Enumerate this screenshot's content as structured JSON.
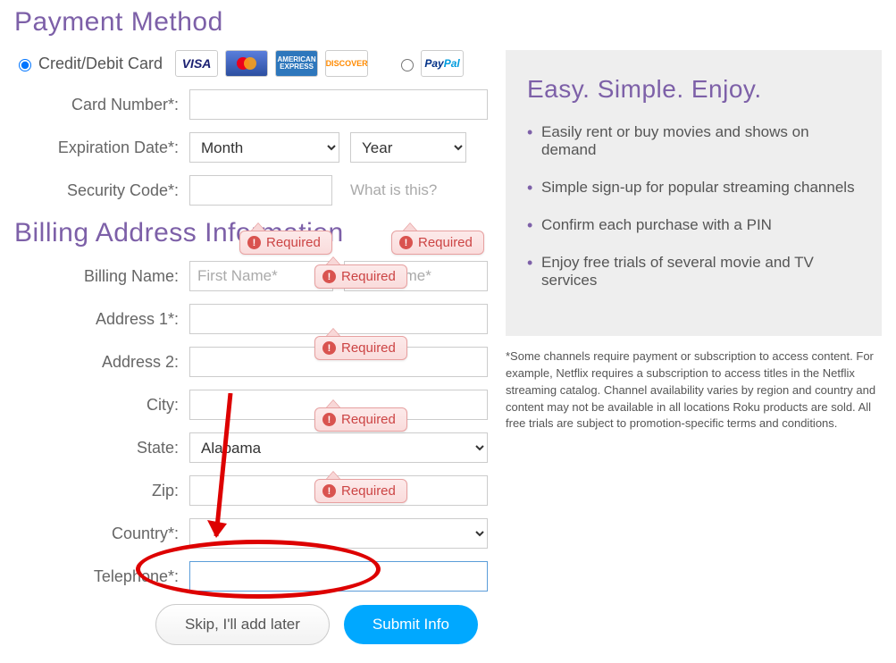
{
  "headings": {
    "payment_method": "Payment Method",
    "billing_address": "Billing Address Information"
  },
  "payment_options": {
    "credit_label": "Credit/Debit Card",
    "paypal_label": "PayPal"
  },
  "card_logos": {
    "visa": "VISA",
    "mastercard": "MasterCard",
    "amex": "AMERICAN EXPRESS",
    "discover": "DISCOVER"
  },
  "labels": {
    "card_number": "Card Number*:",
    "expiration": "Expiration Date*:",
    "security": "Security Code*:",
    "billing_name": "Billing Name:",
    "address1": "Address 1*:",
    "address2": "Address 2:",
    "city": "City:",
    "state": "State:",
    "zip": "Zip:",
    "country": "Country*:",
    "telephone": "Telephone*:"
  },
  "placeholders": {
    "first_name": "First Name*",
    "last_name": "Last Name*"
  },
  "selects": {
    "month": "Month",
    "year": "Year",
    "state_value": "Alabama",
    "country_value": ""
  },
  "links": {
    "what_is_this": "What is this?"
  },
  "validation": {
    "required": "Required"
  },
  "info": {
    "title": "Easy. Simple. Enjoy.",
    "bullets": [
      "Easily rent or buy movies and shows on demand",
      "Simple sign-up for popular streaming channels",
      "Confirm each purchase with a PIN",
      "Enjoy free trials of several movie and TV services"
    ],
    "fineprint": "*Some channels require payment or subscription to access content. For example, Netflix requires a subscription to access titles in the Netflix streaming catalog. Channel availability varies by region and country and content may not be available in all locations Roku products are sold. All free trials are subject to promotion-specific terms and conditions."
  },
  "buttons": {
    "skip": "Skip, I'll add later",
    "submit": "Submit Info"
  },
  "values": {
    "card_number": "",
    "security_code": "",
    "first_name": "",
    "last_name": "",
    "address1": "",
    "address2": "",
    "city": "",
    "zip": "",
    "telephone": ""
  }
}
